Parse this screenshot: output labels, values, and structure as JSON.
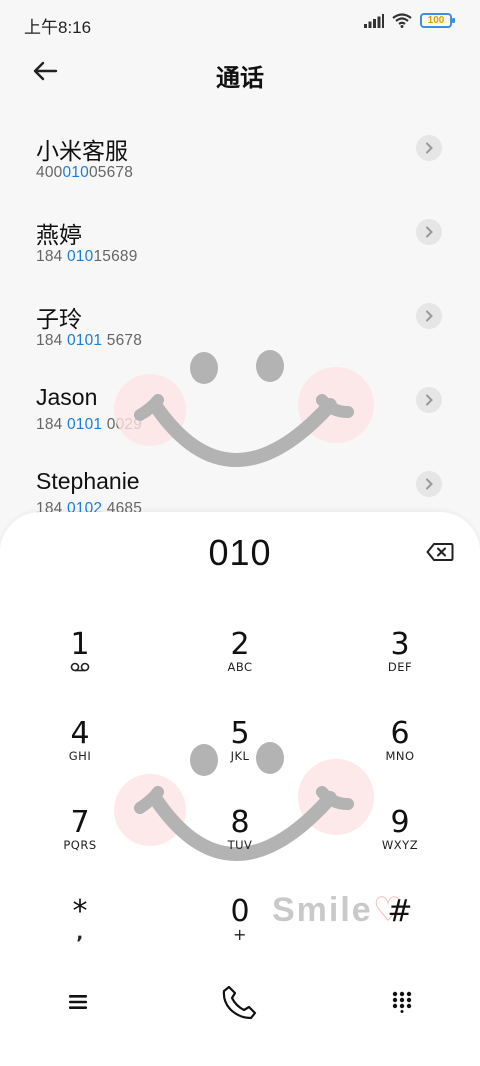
{
  "status_bar": {
    "time": "上午8:16",
    "battery_label": "100"
  },
  "header": {
    "title": "通话"
  },
  "contacts": [
    {
      "name": "小米客服",
      "number_pre": "400",
      "number_hl": "010",
      "number_post": "05678"
    },
    {
      "name": "燕婷",
      "number_pre": "184 ",
      "number_hl": "010",
      "number_post": "15689"
    },
    {
      "name": "子玲",
      "number_pre": "184 ",
      "number_hl": "0101",
      "number_post": " 5678"
    },
    {
      "name": "Jason",
      "number_pre": "184 ",
      "number_hl": "0101",
      "number_post": " 0029"
    },
    {
      "name": "Stephanie",
      "number_pre": "184 ",
      "number_hl": "0102",
      "number_post": " 4685"
    }
  ],
  "dialer": {
    "display": "010",
    "keys": [
      {
        "digit": "1",
        "letters": ""
      },
      {
        "digit": "2",
        "letters": "ABC"
      },
      {
        "digit": "3",
        "letters": "DEF"
      },
      {
        "digit": "4",
        "letters": "GHI"
      },
      {
        "digit": "5",
        "letters": "JKL"
      },
      {
        "digit": "6",
        "letters": "MNO"
      },
      {
        "digit": "7",
        "letters": "PQRS"
      },
      {
        "digit": "8",
        "letters": "TUV"
      },
      {
        "digit": "9",
        "letters": "WXYZ"
      },
      {
        "digit": "*",
        "letters": ","
      },
      {
        "digit": "0",
        "letters": "+"
      },
      {
        "digit": "#",
        "letters": ""
      }
    ]
  },
  "wallpaper": {
    "text": "Smile"
  },
  "colors": {
    "highlight": "#1a7fd8",
    "sheet": "#ffffff",
    "background": "#f7f7f7"
  },
  "icons": {
    "back": "arrow-left-icon",
    "detail": "chevron-right-icon",
    "backspace": "backspace-icon",
    "voicemail": "voicemail-icon",
    "menu": "menu-icon",
    "call": "phone-icon",
    "dialpad": "dialpad-icon"
  }
}
